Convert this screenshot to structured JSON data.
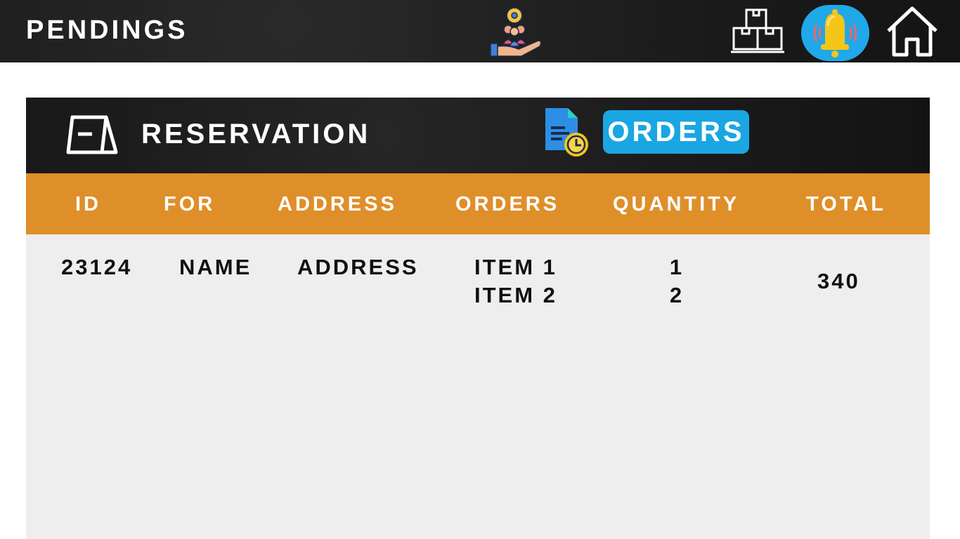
{
  "header": {
    "title": "PENDINGS",
    "logo_icon": "service-hand-gear-icon",
    "nav": [
      {
        "name": "inventory-boxes-icon"
      },
      {
        "name": "notification-bell-icon"
      },
      {
        "name": "home-icon"
      }
    ]
  },
  "panel": {
    "reservation_label": "RESERVATION",
    "reservation_icon": "reservation-sign-icon",
    "orders_label": "ORDERS",
    "orders_icon": "pending-document-clock-icon"
  },
  "table": {
    "columns": [
      "ID",
      "FOR",
      "ADDRESS",
      "ORDERS",
      "QUANTITY",
      "TOTAL"
    ],
    "rows": [
      {
        "id": "23124",
        "for": "NAME",
        "address": "ADDRESS",
        "orders": [
          "ITEM 1",
          "ITEM 2"
        ],
        "quantities": [
          "1",
          "2"
        ],
        "total": "340"
      }
    ]
  },
  "colors": {
    "dark_bar": "#1b1b1b",
    "accent_blue": "#1aa6e2",
    "table_header": "#df8f2a",
    "table_body": "#eeeeee"
  }
}
